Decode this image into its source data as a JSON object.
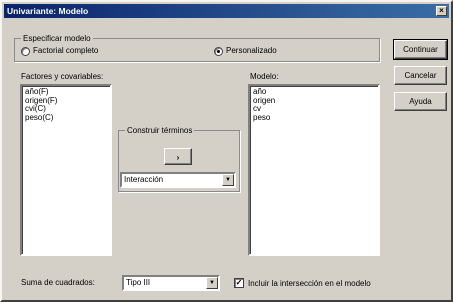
{
  "window": {
    "title": "Univariante: Modelo",
    "close_glyph": "×"
  },
  "specify": {
    "legend": "Especificar modelo",
    "options": [
      {
        "label": "Factorial completo",
        "checked": false
      },
      {
        "label": "Personalizado",
        "checked": true
      }
    ]
  },
  "factors": {
    "label": "Factores y covariables:",
    "items": [
      "año(F)",
      "origen(F)",
      "cvi(C)",
      "peso(C)"
    ]
  },
  "build_terms": {
    "legend": "Construir términos",
    "arrow_glyph": "›",
    "type_value": "Interacción"
  },
  "model": {
    "label": "Modelo:",
    "items": [
      "año",
      "origen",
      "cv",
      "peso"
    ]
  },
  "buttons": {
    "continue": "Continuar",
    "cancel": "Cancelar",
    "help": "Ayuda"
  },
  "sum_squares": {
    "label": "Suma de cuadrados:",
    "value": "Tipo III"
  },
  "intercept": {
    "label": "Incluir la intersección en el modelo",
    "checked": true,
    "check_glyph": "✓"
  }
}
